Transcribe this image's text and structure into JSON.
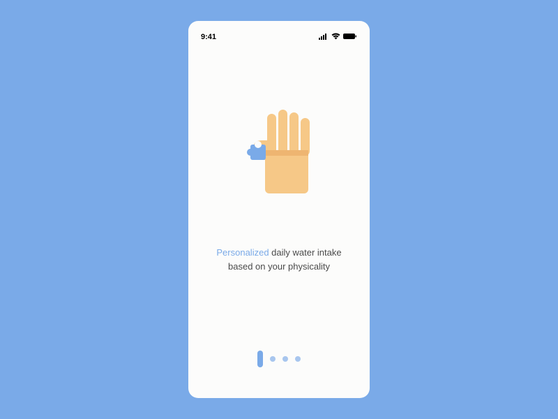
{
  "status_bar": {
    "time": "9:41"
  },
  "onboarding": {
    "highlight_word": "Personalized",
    "description_rest": " daily water intake based on your physicality"
  },
  "pagination": {
    "current": 1,
    "total": 4
  },
  "colors": {
    "background": "#7aaae8",
    "hand": "#f6c887",
    "hand_shadow": "#e8a55f",
    "puzzle": "#7aaae8"
  }
}
